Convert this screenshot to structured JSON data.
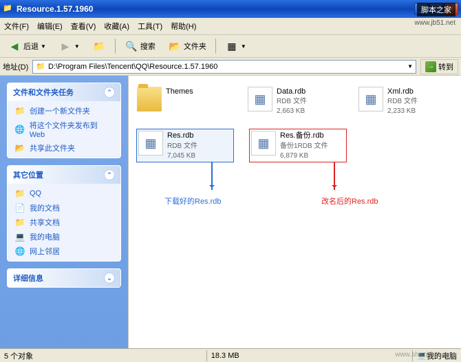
{
  "window": {
    "title": "Resource.1.57.1960"
  },
  "menu": {
    "file": "文件(F)",
    "edit": "编辑(E)",
    "view": "查看(V)",
    "favorites": "收藏(A)",
    "tools": "工具(T)",
    "help": "帮助(H)"
  },
  "toolbar": {
    "back": "后退",
    "search": "搜索",
    "folders": "文件夹"
  },
  "address": {
    "label": "地址(D)",
    "path": "D:\\Program Files\\Tencent\\QQ\\Resource.1.57.1960",
    "go": "转到"
  },
  "sidebar": {
    "tasks": {
      "title": "文件和文件夹任务",
      "items": [
        "创建一个新文件夹",
        "将这个文件夹发布到 Web",
        "共享此文件夹"
      ]
    },
    "places": {
      "title": "其它位置",
      "items": [
        "QQ",
        "我的文档",
        "共享文档",
        "我的电脑",
        "网上邻居"
      ]
    },
    "details": {
      "title": "详细信息"
    }
  },
  "files": [
    {
      "name": "Themes",
      "type": "",
      "size": "",
      "iconType": "folder"
    },
    {
      "name": "Data.rdb",
      "type": "RDB 文件",
      "size": "2,663 KB",
      "iconType": "rdb"
    },
    {
      "name": "Xml.rdb",
      "type": "RDB 文件",
      "size": "2,233 KB",
      "iconType": "rdb"
    },
    {
      "name": "Res.rdb",
      "type": "RDB 文件",
      "size": "7,045 KB",
      "iconType": "rdb",
      "selected": true
    },
    {
      "name": "Res.备份.rdb",
      "type": "备份1RDB 文件",
      "size": "6,879 KB",
      "iconType": "rdb",
      "redbox": true
    }
  ],
  "annotations": {
    "blue_prefix": "下载好的",
    "blue_file": "Res.rdb",
    "red_prefix": "改名后的",
    "red_file": "Res.rdb"
  },
  "status": {
    "objects": "5 个对象",
    "size": "18.3 MB",
    "location": "我的电脑"
  },
  "watermarks": {
    "top1": "脚本之家",
    "top2": "www.jb51.net",
    "bottom1": "",
    "bottom2": "www.shazidian.com"
  }
}
